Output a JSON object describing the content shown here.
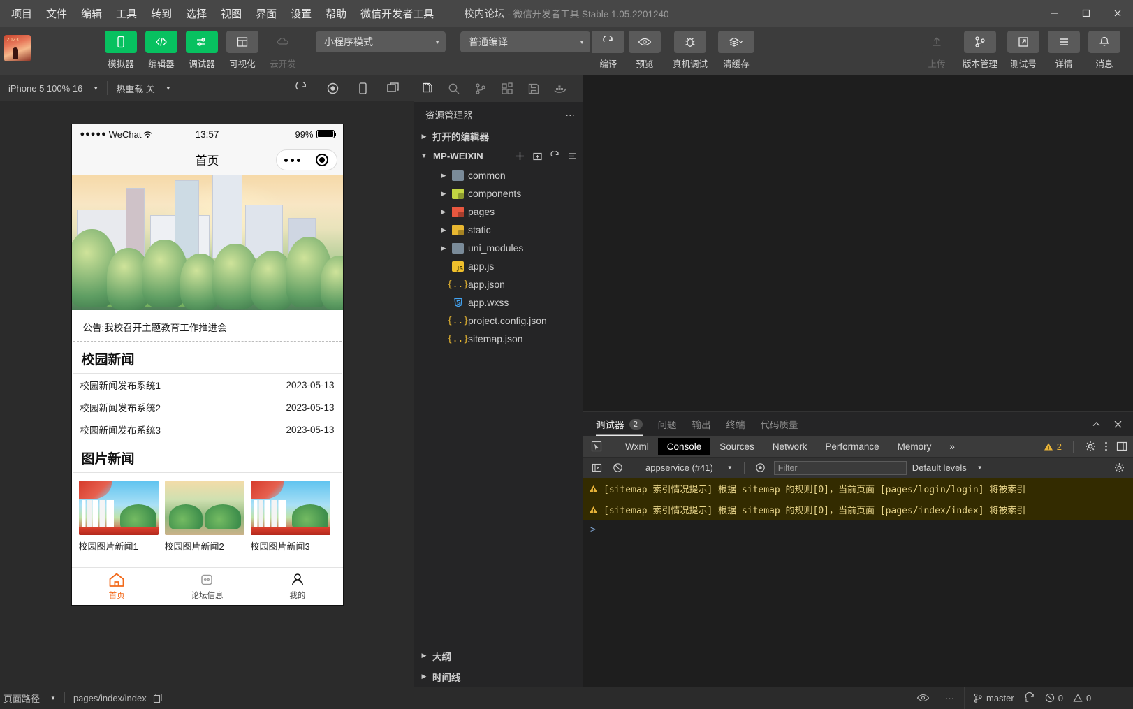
{
  "titlebar": {
    "menus": [
      "项目",
      "文件",
      "编辑",
      "工具",
      "转到",
      "选择",
      "视图",
      "界面",
      "设置",
      "帮助",
      "微信开发者工具"
    ],
    "project_name": "校内论坛",
    "app_subtitle": "- 微信开发者工具 Stable 1.05.2201240",
    "window_controls": {
      "minimize": "minimize-icon",
      "maximize": "maximize-icon",
      "close": "close-icon"
    }
  },
  "toolbar": {
    "logo_year": "2023",
    "left_buttons": [
      {
        "label": "模拟器",
        "icon": "phone-icon",
        "state": "active"
      },
      {
        "label": "编辑器",
        "icon": "code-icon",
        "state": "active"
      },
      {
        "label": "调试器",
        "icon": "sliders-icon",
        "state": "active"
      },
      {
        "label": "可视化",
        "icon": "layout-icon",
        "state": "normal"
      },
      {
        "label": "云开发",
        "icon": "cloud-icon",
        "state": "disabled"
      }
    ],
    "mode_select": "小程序模式",
    "compile_select": "普通编译",
    "mid_buttons": [
      {
        "label": "编译",
        "icon": "refresh-icon"
      },
      {
        "label": "预览",
        "icon": "eye-icon"
      },
      {
        "label": "真机调试",
        "icon": "bug-icon"
      },
      {
        "label": "清缓存",
        "icon": "layers-icon"
      }
    ],
    "right_buttons": [
      {
        "label": "上传",
        "icon": "upload-icon",
        "state": "disabled"
      },
      {
        "label": "版本管理",
        "icon": "branch-icon",
        "state": "normal"
      },
      {
        "label": "测试号",
        "icon": "external-link-icon",
        "state": "normal"
      },
      {
        "label": "详情",
        "icon": "menu-icon",
        "state": "normal"
      },
      {
        "label": "消息",
        "icon": "bell-icon",
        "state": "normal"
      }
    ]
  },
  "simulator_bar": {
    "device": "iPhone 5 100% 16",
    "hot_reload": "热重载 关",
    "icons": [
      "refresh-icon",
      "record-icon",
      "device-icon",
      "window-icon"
    ]
  },
  "phone": {
    "status": {
      "carrier": "WeChat",
      "dots": "●●●●●",
      "time": "13:57",
      "battery": "99%"
    },
    "nav_title": "首页",
    "notice": "公告:我校召开主题教育工作推进会",
    "sections": [
      {
        "title": "校园新闻"
      },
      {
        "title": "图片新闻"
      }
    ],
    "news": [
      {
        "title": "校园新闻发布系统1",
        "date": "2023-05-13"
      },
      {
        "title": "校园新闻发布系统2",
        "date": "2023-05-13"
      },
      {
        "title": "校园新闻发布系统3",
        "date": "2023-05-13"
      }
    ],
    "pictures": [
      {
        "caption": "校园图片新闻1"
      },
      {
        "caption": "校园图片新闻2"
      },
      {
        "caption": "校园图片新闻3"
      }
    ],
    "tabs": [
      {
        "label": "首页",
        "icon": "home-icon",
        "active": true
      },
      {
        "label": "论坛信息",
        "icon": "message-icon",
        "active": false
      },
      {
        "label": "我的",
        "icon": "person-icon",
        "active": false
      }
    ],
    "accent_color": "#f26a1b"
  },
  "explorer": {
    "activity_icons": [
      "files-icon",
      "search-icon",
      "source-control-icon",
      "extensions-icon",
      "save-icon",
      "docker-icon"
    ],
    "title": "资源管理器",
    "more_label": "···",
    "open_editors": "打开的编辑器",
    "project": "MP-WEIXIN",
    "project_actions": [
      "new-file-icon",
      "new-folder-icon",
      "refresh-icon",
      "collapse-icon"
    ],
    "tree": [
      {
        "name": "common",
        "type": "folder",
        "color": "gray"
      },
      {
        "name": "components",
        "type": "folder",
        "color": "green"
      },
      {
        "name": "pages",
        "type": "folder",
        "color": "red"
      },
      {
        "name": "static",
        "type": "folder",
        "color": "yellow"
      },
      {
        "name": "uni_modules",
        "type": "folder",
        "color": "gray"
      },
      {
        "name": "app.js",
        "type": "js"
      },
      {
        "name": "app.json",
        "type": "json"
      },
      {
        "name": "app.wxss",
        "type": "css"
      },
      {
        "name": "project.config.json",
        "type": "json"
      },
      {
        "name": "sitemap.json",
        "type": "json"
      }
    ],
    "bottom_sections": [
      "大纲",
      "时间线"
    ]
  },
  "panel": {
    "tabs": [
      {
        "label": "调试器",
        "count": "2",
        "active": true
      },
      {
        "label": "问题",
        "active": false
      },
      {
        "label": "输出",
        "active": false
      },
      {
        "label": "终端",
        "active": false
      },
      {
        "label": "代码质量",
        "active": false
      }
    ],
    "tools": [
      "chevron-up-icon",
      "close-icon"
    ],
    "devtools_tabs": [
      {
        "label": "Wxml",
        "active": false
      },
      {
        "label": "Console",
        "active": true
      },
      {
        "label": "Sources",
        "active": false
      },
      {
        "label": "Network",
        "active": false
      },
      {
        "label": "Performance",
        "active": false
      },
      {
        "label": "Memory",
        "active": false
      }
    ],
    "devtools_more": "»",
    "warning_count": "2",
    "console": {
      "context": "appservice (#41)",
      "filter_placeholder": "Filter",
      "levels": "Default levels",
      "messages": [
        "[sitemap 索引情况提示] 根据 sitemap 的规则[0]，当前页面 [pages/login/login] 将被索引",
        "[sitemap 索引情况提示] 根据 sitemap 的规则[0]，当前页面 [pages/index/index] 将被索引"
      ],
      "prompt": ">"
    }
  },
  "statusbar": {
    "page_path_label": "页面路径",
    "page_path": "pages/index/index",
    "copy_icon": "copy-icon",
    "eye_icon": "eye-icon",
    "more": "···",
    "branch": "master",
    "sync_icon": "sync-icon",
    "errors": "0",
    "warnings": "0"
  }
}
